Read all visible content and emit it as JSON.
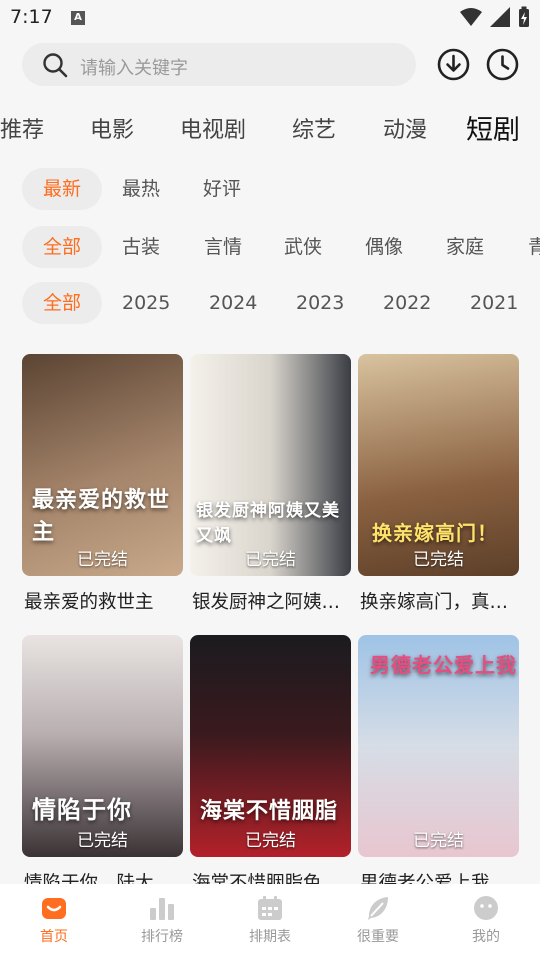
{
  "status": {
    "time": "7:17",
    "notif_letter": "A"
  },
  "search": {
    "placeholder": "请输入关键字"
  },
  "categories": [
    {
      "label": "推荐"
    },
    {
      "label": "电影"
    },
    {
      "label": "电视剧"
    },
    {
      "label": "综艺"
    },
    {
      "label": "动漫"
    },
    {
      "label": "短剧",
      "active": true
    }
  ],
  "sort_filters": [
    {
      "label": "最新",
      "active": true
    },
    {
      "label": "最热"
    },
    {
      "label": "好评"
    }
  ],
  "genre_filters": [
    {
      "label": "全部",
      "active": true
    },
    {
      "label": "古装"
    },
    {
      "label": "言情"
    },
    {
      "label": "武侠"
    },
    {
      "label": "偶像"
    },
    {
      "label": "家庭"
    },
    {
      "label": "青"
    }
  ],
  "year_filters": [
    {
      "label": "全部",
      "active": true
    },
    {
      "label": "2025"
    },
    {
      "label": "2024"
    },
    {
      "label": "2023"
    },
    {
      "label": "2022"
    },
    {
      "label": "2021"
    }
  ],
  "cards": [
    {
      "title": "最亲爱的救世主",
      "status": "已完结",
      "poster_text": "最亲爱的救世主",
      "color1": "#5b4433",
      "color2": "#c9a98a"
    },
    {
      "title": "银发厨神之阿姨…",
      "status": "已完结",
      "poster_text": "银发厨神阿姨又美又飒",
      "color1": "#f2efe8",
      "color2": "#3a3d44"
    },
    {
      "title": "换亲嫁高门，真…",
      "status": "已完结",
      "poster_text": "换亲嫁高门！",
      "color1": "#8a6140",
      "color2": "#d9c3a0"
    },
    {
      "title": "情陷于你，陆大…",
      "status": "已完结",
      "poster_text": "情陷于你",
      "color1": "#d8d2cf",
      "color2": "#3b3235"
    },
    {
      "title": "海棠不惜胭脂色",
      "status": "已完结",
      "poster_text": "海棠不惜胭脂",
      "color1": "#1b1b1f",
      "color2": "#b3212a"
    },
    {
      "title": "男德老公爱上我",
      "status": "已完结",
      "poster_text": "男德老公爱上我",
      "color1": "#9fc3e6",
      "color2": "#e8c6cf"
    }
  ],
  "nav": [
    {
      "label": "首页",
      "active": true
    },
    {
      "label": "排行榜"
    },
    {
      "label": "排期表"
    },
    {
      "label": "很重要"
    },
    {
      "label": "我的"
    }
  ],
  "colors": {
    "accent": "#ff6d1f",
    "background": "#f6f6f6"
  }
}
